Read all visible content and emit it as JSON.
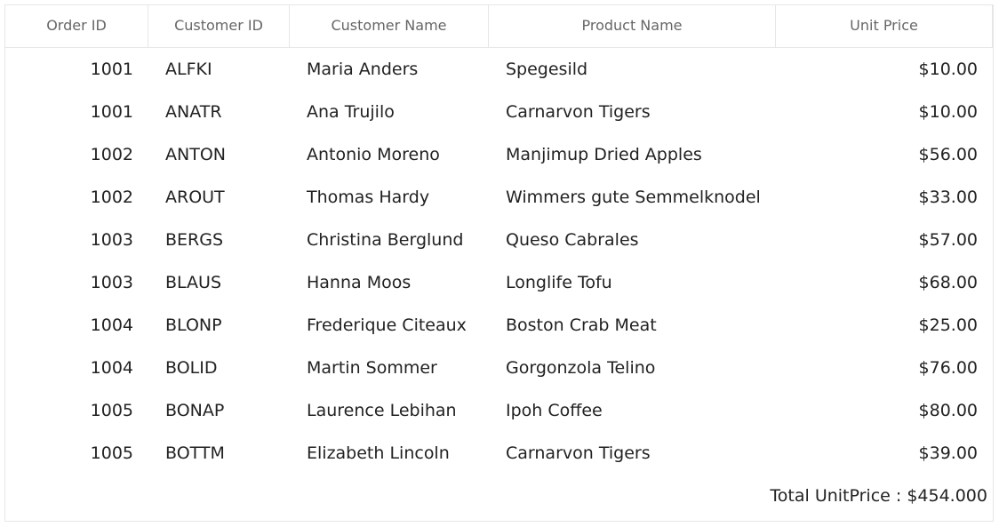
{
  "grid": {
    "columns": [
      "Order ID",
      "Customer ID",
      "Customer Name",
      "Product Name",
      "Unit Price"
    ],
    "rows": [
      {
        "order_id": "1001",
        "customer_id": "ALFKI",
        "customer_name": "Maria Anders",
        "product_name": "Spegesild",
        "unit_price": "$10.00"
      },
      {
        "order_id": "1001",
        "customer_id": "ANATR",
        "customer_name": "Ana Trujilo",
        "product_name": "Carnarvon Tigers",
        "unit_price": "$10.00"
      },
      {
        "order_id": "1002",
        "customer_id": "ANTON",
        "customer_name": "Antonio Moreno",
        "product_name": "Manjimup Dried Apples",
        "unit_price": "$56.00"
      },
      {
        "order_id": "1002",
        "customer_id": "AROUT",
        "customer_name": "Thomas Hardy",
        "product_name": "Wimmers gute Semmelknodel",
        "unit_price": "$33.00"
      },
      {
        "order_id": "1003",
        "customer_id": "BERGS",
        "customer_name": "Christina Berglund",
        "product_name": "Queso Cabrales",
        "unit_price": "$57.00"
      },
      {
        "order_id": "1003",
        "customer_id": "BLAUS",
        "customer_name": "Hanna Moos",
        "product_name": "Longlife Tofu",
        "unit_price": "$68.00"
      },
      {
        "order_id": "1004",
        "customer_id": "BLONP",
        "customer_name": "Frederique Citeaux",
        "product_name": "Boston Crab Meat",
        "unit_price": "$25.00"
      },
      {
        "order_id": "1004",
        "customer_id": "BOLID",
        "customer_name": "Martin Sommer",
        "product_name": "Gorgonzola Telino",
        "unit_price": "$76.00"
      },
      {
        "order_id": "1005",
        "customer_id": "BONAP",
        "customer_name": "Laurence Lebihan",
        "product_name": "Ipoh Coffee",
        "unit_price": "$80.00"
      },
      {
        "order_id": "1005",
        "customer_id": "BOTTM",
        "customer_name": "Elizabeth Lincoln",
        "product_name": "Carnarvon Tigers",
        "unit_price": "$39.00"
      }
    ],
    "summary": "Total UnitPrice : $454.000"
  },
  "colors": {
    "border": "#e6e6e6",
    "header_text": "#666666",
    "cell_text": "#222222"
  }
}
